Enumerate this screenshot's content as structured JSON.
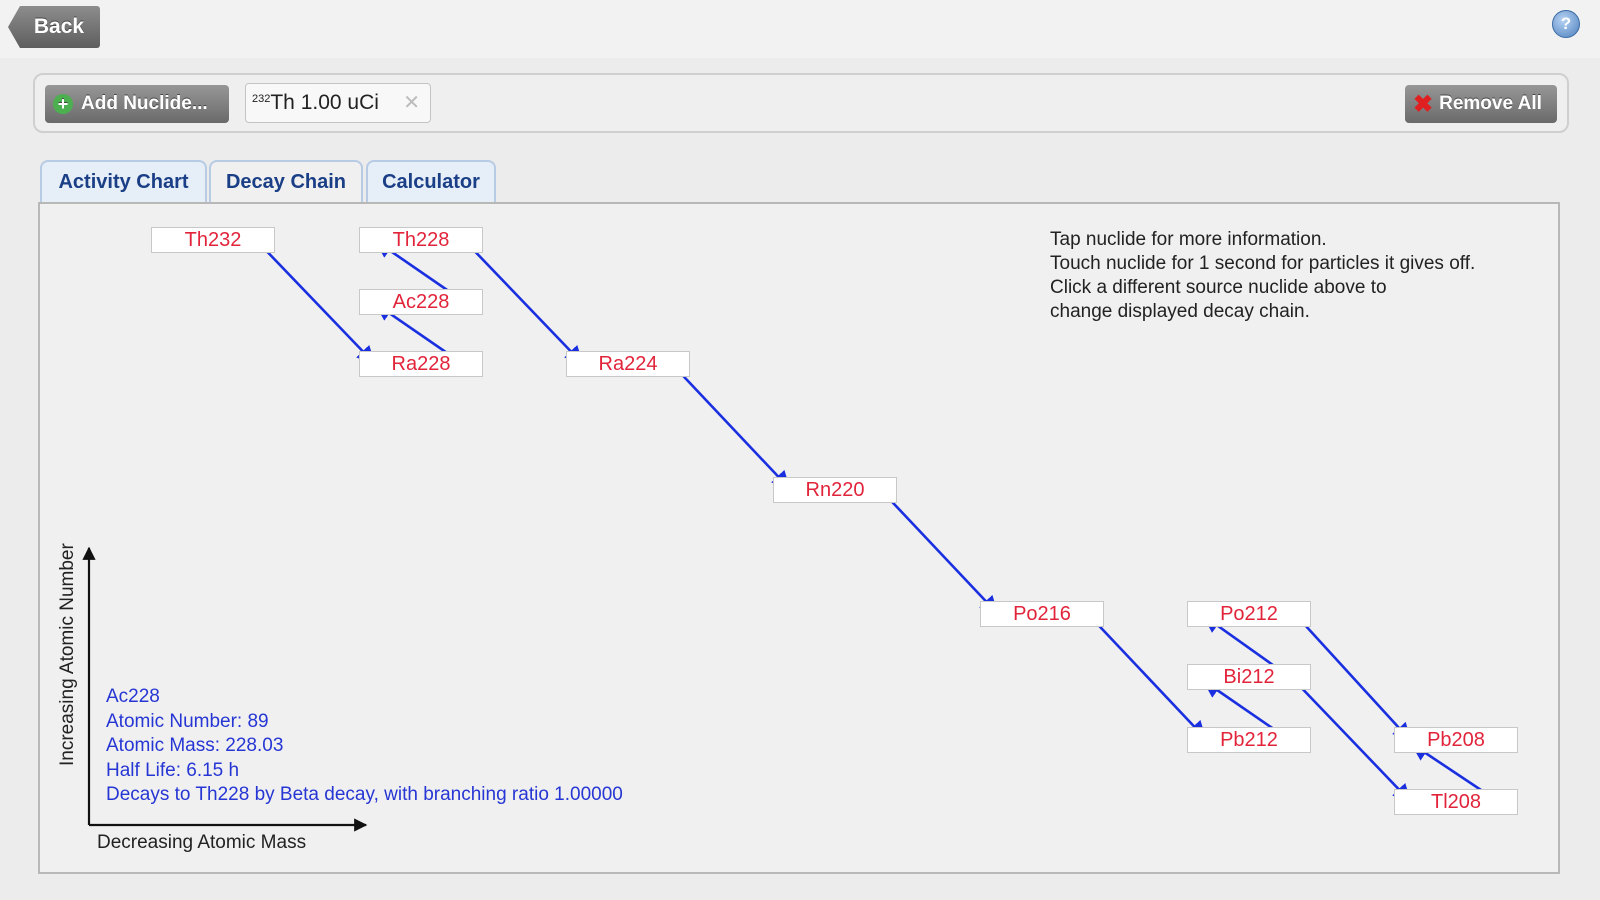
{
  "topbar": {
    "back_label": "Back",
    "help_glyph": "?"
  },
  "nuclide_bar": {
    "add_label": "Add Nuclide...",
    "add_icon_glyph": "+",
    "chip": {
      "mass": "232",
      "symbol": "Th 1.00 uCi",
      "close_glyph": "✕"
    },
    "remove_icon_glyph": "✖",
    "remove_label": "Remove All"
  },
  "tabs": [
    {
      "label": "Activity Chart",
      "active": false
    },
    {
      "label": "Decay Chain",
      "active": true
    },
    {
      "label": "Calculator",
      "active": false
    }
  ],
  "decay_chain": {
    "nuclides": [
      "Th232",
      "Th228",
      "Ac228",
      "Ra228",
      "Ra224",
      "Rn220",
      "Po216",
      "Po212",
      "Bi212",
      "Pb212",
      "Pb208",
      "Tl208"
    ],
    "instructions": [
      "Tap nuclide for more information.",
      "Touch nuclide for 1 second for particles it gives off.",
      "Click a different source nuclide above to",
      "change displayed decay chain."
    ],
    "selected_info": [
      "Ac228",
      "Atomic Number: 89",
      "Atomic Mass: 228.03",
      "Half Life: 6.15 h",
      "Decays to Th228 by Beta decay, with branching ratio 1.00000"
    ],
    "x_axis_label": "Decreasing Atomic Mass",
    "y_axis_label": "Increasing Atomic Number"
  },
  "colors": {
    "nuclide_text": "#e2243b",
    "arrow": "#1a2fe0",
    "info_text": "#2636d4",
    "tab_text": "#1a3f86"
  }
}
